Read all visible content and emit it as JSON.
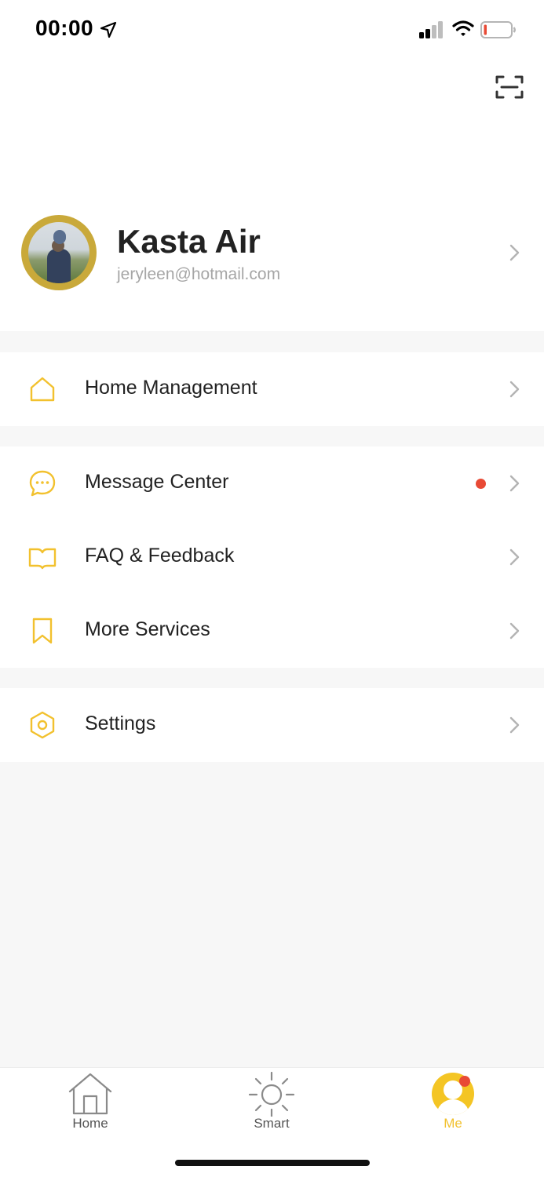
{
  "status_bar": {
    "time": "00:00",
    "icons": [
      "location-arrow-icon",
      "cellular-signal-icon",
      "wifi-icon",
      "battery-low-icon"
    ]
  },
  "header": {
    "scan_icon": "scan-icon"
  },
  "profile": {
    "name": "Kasta Air",
    "email": "jeryleen@hotmail.com",
    "avatar": "profile-avatar"
  },
  "menu": {
    "groups": [
      [
        {
          "label": "Home Management",
          "icon": "home-icon"
        }
      ],
      [
        {
          "label": "Message Center",
          "icon": "message-icon",
          "badge": true
        },
        {
          "label": "FAQ & Feedback",
          "icon": "book-icon"
        },
        {
          "label": "More Services",
          "icon": "bookmark-icon"
        }
      ],
      [
        {
          "label": "Settings",
          "icon": "settings-icon"
        }
      ]
    ]
  },
  "tabbar": {
    "tabs": [
      {
        "label": "Home",
        "icon": "home-tab-icon",
        "active": false
      },
      {
        "label": "Smart",
        "icon": "sun-icon",
        "active": false
      },
      {
        "label": "Me",
        "icon": "me-avatar-icon",
        "active": true,
        "badge": true
      }
    ]
  },
  "colors": {
    "accent": "#f2c12e",
    "badge": "#e84a35",
    "background": "#f7f7f7",
    "text": "#222222",
    "secondary_text": "#a6a6a6"
  }
}
